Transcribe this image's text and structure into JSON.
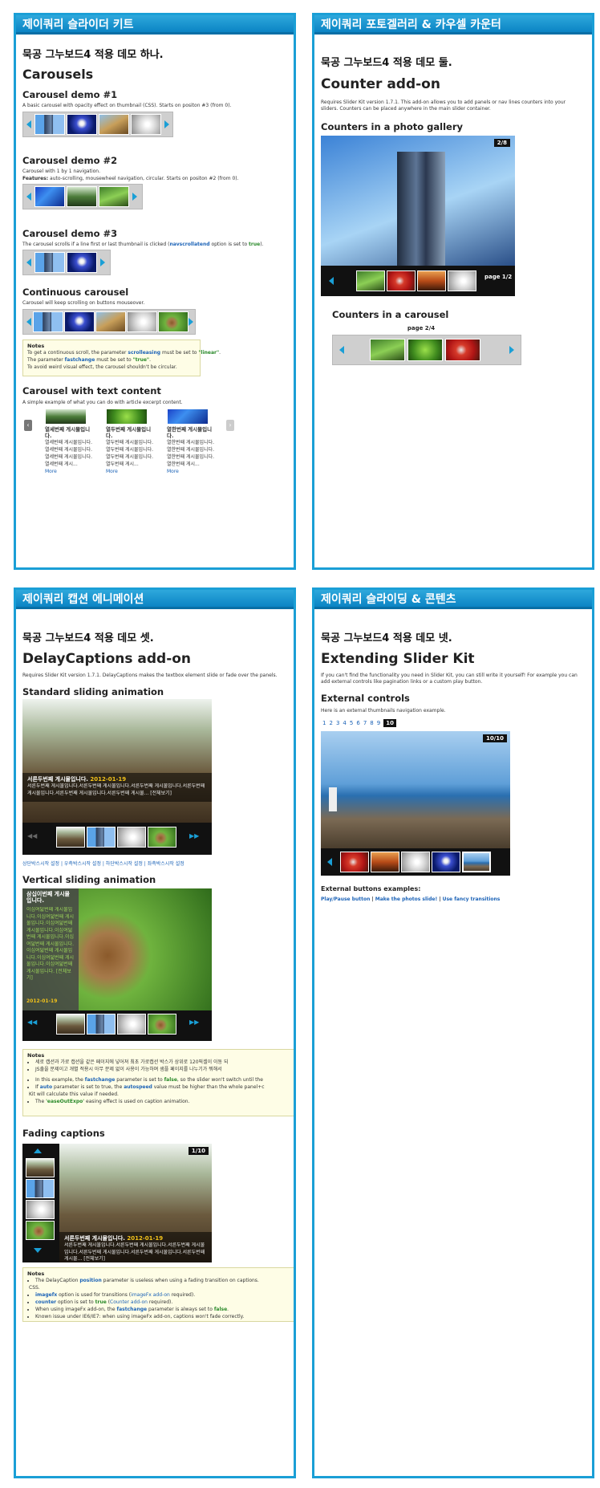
{
  "p1": {
    "header": "제이쿼리 슬라이더 키트",
    "demo_kor": "묵공 그누보드4 적용 데모 하나.",
    "title": "Carousels",
    "d1_title": "Carousel demo #1",
    "d1_desc": "A basic carousel with opacity effect on thumbnail (CSS). Starts on positon #3 (from 0).",
    "d2_title": "Carousel demo #2",
    "d2_desc1": "Carousel with 1 by 1 navigation.",
    "d2_feat_label": "Features:",
    "d2_feat": " auto-scrolling, mousewheel navigation, circular. Starts on positon #2 (from 0).",
    "d3_title": "Carousel demo #3",
    "d3_desc_a": "The carousel scrolls if a line first or last thumbnail is clicked (",
    "d3_desc_kw": "navscrollatend",
    "d3_desc_b": " option is set to ",
    "d3_desc_val": "true",
    "d3_desc_c": ").",
    "cont_title": "Continuous carousel",
    "cont_desc": "Carousel will keep scrolling on buttons mouseover.",
    "notes": {
      "title": "Notes",
      "l1a": "To get a continuous scroll, the parameter ",
      "l1kw": "scrolleasing",
      "l1b": " must be set to ",
      "l1v": "\"linear\"",
      "l1c": ".",
      "l2a": "The parameter ",
      "l2kw": "fastchange",
      "l2b": " must be set to ",
      "l2v": "\"true\"",
      "l2c": ".",
      "l3": "To avoid weird visual effect, the carousel shouldn't be circular."
    },
    "text_title": "Carousel with text content",
    "text_desc": "A simple example of what you can do with article excerpt content.",
    "articles": [
      {
        "title": "열세번째 게시물입니다.",
        "body": [
          "열세번째 게시물입니다.",
          "열세번째 게시물입니다.",
          "열세번째 게시물입니다.",
          "열세번째 게시..."
        ],
        "more": "More"
      },
      {
        "title": "열두번째 게시물입니다.",
        "body": [
          "열두번째 게시물입니다.",
          "열두번째 게시물입니다.",
          "열두번째 게시물입니다.",
          "열두번째 게시..."
        ],
        "more": "More"
      },
      {
        "title": "열한번째 게시물입니다.",
        "body": [
          "열한번째 게시물입니다.",
          "열한번째 게시물입니다.",
          "열한번째 게시물입니다.",
          "열한번째 게시..."
        ],
        "more": "More"
      }
    ]
  },
  "p2": {
    "header": "제이쿼리 포토겔러리 & 카우셀 카운터",
    "demo_kor": "묵공 그누보드4 적용 데모 둘.",
    "title": "Counter add-on",
    "desc1": "Requires Slider Kit version 1.7.1. This add-on allows you to add panels or nav lines counters into your",
    "desc2": "sliders. Counters can be placed anywhere in the main slider container.",
    "gallery_title": "Counters in a photo gallery",
    "gallery_badge": "2/8",
    "gallery_page": "page 1/2",
    "carousel_title": "Counters in a carousel",
    "carousel_page": "page 2/4"
  },
  "p3": {
    "header": "제이쿼리 캡션 에니메이션",
    "demo_kor": "묵공 그누보드4 적용 데모 셋.",
    "title": "DelayCaptions add-on",
    "desc": "Requires Slider Kit version 1.7.1. DelayCaptions makes the textbox element slide or fade over the panels.",
    "std_title": "Standard sliding animation",
    "std_cap_title": "서른두번째 게시물입니다.",
    "std_cap_date": "2012-01-19",
    "std_cap_body": "서른두번째 게시물입니다.서른두번째 게시물입니다.서른두번째 게시물입니다.서른두번째 게시물입니다.서른두번째 게시물입니다.서른두번째 게시물... [전체보기]",
    "std_links": "상단박스시작 설정 | 우측박스시작 설정 | 하단박스시작 설정 | 좌측박스시작 설정",
    "vert_title": "Vertical sliding animation",
    "vert_cap_title": "삼십이번째 게시물입니다.",
    "vert_cap_body": "이십여덟번째 게시물입니다.이십여덟번째 게시물입니다.이십여덟번째 게시물입니다.이십여덟번째 게시물입니다.이십여덟번째 게시물입니다.이십여덟번째 게시물입니다.이십여덟번째 게시물입니다.이십여덟번째 게시물입니다. [전체보기]",
    "vert_cap_date": "2012-01-19",
    "notes": {
      "title": "Notes",
      "k1": "세로 캡션과 가로 캡션을 같은 페이지에 넣어져 최초 가로캡션 박스가 상위로 120픽셀이 이동 되",
      "k2": "JS출을 문제이고 개별 적용시 아무 문제 없이 사용이 가능하며 샘플 페이지를 나누기가 뭐해서",
      "e1a": "In this example, the ",
      "e1kw": "fastchange",
      "e1b": " parameter is set to ",
      "e1v": "false",
      "e1c": ", so the slider won't switch until the",
      "e2a": "If ",
      "e2kw": "auto",
      "e2b": " parameter is set to true, the ",
      "e2kw2": "autospeed",
      "e2c": " value must be higher than the whole panel+c",
      "e2d": "Kit will calculate this value if needed.",
      "e3a": "The ",
      "e3kw": "'easeOutExpo'",
      "e3b": " easing effect is used on caption animation."
    },
    "fade_title": "Fading captions",
    "fade_badge": "1/10",
    "fade_cap_title": "서른두번째 게시물입니다.",
    "fade_cap_date": "2012-01-19",
    "fade_cap_body": "서른두번째 게시물입니다.서른두번째 게시물입니다.서른두번째 게시물입니다.서른두번째 게시물입니다.서른두번째 게시물입니다.서른두번째 게시물... [전체보기]",
    "notes2": {
      "title": "Notes",
      "b1a": "The DelayCaption ",
      "b1kw": "position",
      "b1b": " parameter is useless when using a fading transition on captions.",
      "b1c": "CSS.",
      "b2kw": "imagefx",
      "b2a": " option is used for transitions (",
      "b2kw2": "imageFx add-on",
      "b2b": " required).",
      "b3kw": "counter",
      "b3a": " option is set to ",
      "b3v": "true",
      "b3b": " (",
      "b3kw2": "Counter add-on",
      "b3c": " required).",
      "b4a": "When using imageFx add-on, the ",
      "b4kw": "fastchange",
      "b4b": " parameter is always set to ",
      "b4v": "false",
      "b4c": ".",
      "b5": "Known issue under IE6/IE7: when using imageFx add-on, captions won't fade correctly."
    }
  },
  "p4": {
    "header": "제이쿼리 슬라이딩 & 콘텐츠",
    "demo_kor": "묵공 그누보드4 적용 데모 넷.",
    "title": "Extending Slider Kit",
    "desc1": "If you can't find the functionality you need in Slider Kit, you can still write it yourself! For example you can",
    "desc2": "add external controls like pagination links or a custom play button.",
    "ext_title": "External controls",
    "ext_desc": "Here is an external thumbnails navigation example.",
    "pager": [
      "1",
      "2",
      "3",
      "4",
      "5",
      "6",
      "7",
      "8",
      "9",
      "10"
    ],
    "badge": "10/10",
    "btn_title": "External buttons examples:",
    "btn1": "Play/Pause button",
    "btn2": "Make the photos slide!",
    "btn3": "Use fancy transitions",
    "sep": " | "
  }
}
